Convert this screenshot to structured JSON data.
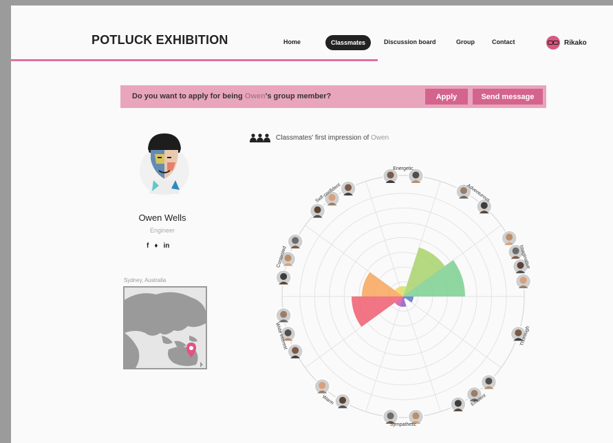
{
  "header": {
    "brand": "POTLUCK EXHIBITION",
    "nav": {
      "home": "Home",
      "classmates": "Classmates",
      "discussion": "Discussion board",
      "group": "Group",
      "contact": "Contact"
    },
    "user_name": "Rikako"
  },
  "banner": {
    "question_prefix": "Do you want to apply for being ",
    "question_name": "Owen",
    "question_suffix": "'s group member?",
    "apply_label": "Apply",
    "send_message_label": "Send message"
  },
  "profile": {
    "name": "Owen Wells",
    "title": "Engineer",
    "socials": {
      "facebook": "f",
      "twitter": "♦",
      "linkedin": "in"
    },
    "location": "Sydney, Australia"
  },
  "impression": {
    "prefix": "Classmates' first impression of ",
    "name": "Owen",
    "traits": [
      "Energetic",
      "Adventurous",
      "Imaginative",
      "Thorough",
      "Efficient",
      "Sympathetic",
      "Warm",
      "Wide interest",
      "Contented",
      "Self-confident"
    ]
  },
  "chart_data": {
    "type": "polar-area",
    "categories": [
      "Energetic",
      "Adventurous",
      "Imaginative",
      "Thorough",
      "Efficient",
      "Sympathetic",
      "Warm",
      "Wide interest",
      "Contented",
      "Self-confident"
    ],
    "values": [
      1,
      5,
      6,
      1,
      0,
      1,
      1,
      5,
      4,
      1
    ],
    "max": 10,
    "colors": [
      "#cfe06a",
      "#a8d26a",
      "#7dcf8f",
      "#5a77c8",
      "#4a67c2",
      "#8f5cc4",
      "#d656a2",
      "#ee5d6e",
      "#f7a45a",
      "#f2d35a"
    ],
    "avatar_counts": [
      2,
      2,
      4,
      1,
      3,
      2,
      2,
      3,
      3,
      3
    ]
  }
}
